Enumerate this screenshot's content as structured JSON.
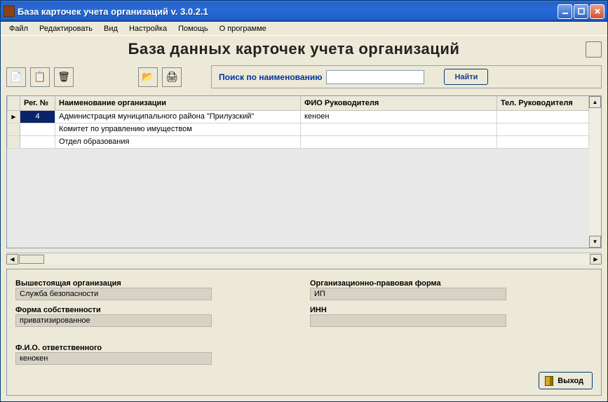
{
  "window": {
    "title": "База карточек учета организаций v.  3.0.2.1"
  },
  "menu": {
    "items": [
      "Файл",
      "Редактировать",
      "Вид",
      "Настройка",
      "Помощь",
      "О программе"
    ]
  },
  "pageTitle": "База данных карточек учета организаций",
  "toolbar": {
    "newCard": "📄",
    "copyCard": "📋",
    "deleteCard": "🗑",
    "openCard": "📂",
    "printCard": "🖨"
  },
  "search": {
    "label": "Поиск по наименованию",
    "value": "",
    "button": "Найти"
  },
  "grid": {
    "columns": {
      "reg": "Рег. №",
      "name": "Наименование организации",
      "fio": "ФИО Руководителя",
      "tel": "Тел. Руководителя"
    },
    "rows": [
      {
        "reg": "4",
        "name": "Администрация муниципального района \"Прилузский\"",
        "fio": "кеноен",
        "tel": "",
        "selected": true
      },
      {
        "reg": "",
        "name": "Комитет по управлению имуществом",
        "fio": "",
        "tel": "",
        "selected": false
      },
      {
        "reg": "",
        "name": "Отдел образования",
        "fio": "",
        "tel": "",
        "selected": false
      }
    ]
  },
  "details": {
    "parentOrgLabel": "Вышестоящая организация",
    "parentOrgValue": "Служба безопасности",
    "ownershipLabel": "Форма собственности",
    "ownershipValue": "приватизированное",
    "legalFormLabel": "Организационно-правовая форма",
    "legalFormValue": "ИП",
    "innLabel": "ИНН",
    "innValue": "",
    "responsibleLabel": "Ф.И.О.  ответственного",
    "responsibleValue": "кенокен"
  },
  "exitButton": "Выход"
}
